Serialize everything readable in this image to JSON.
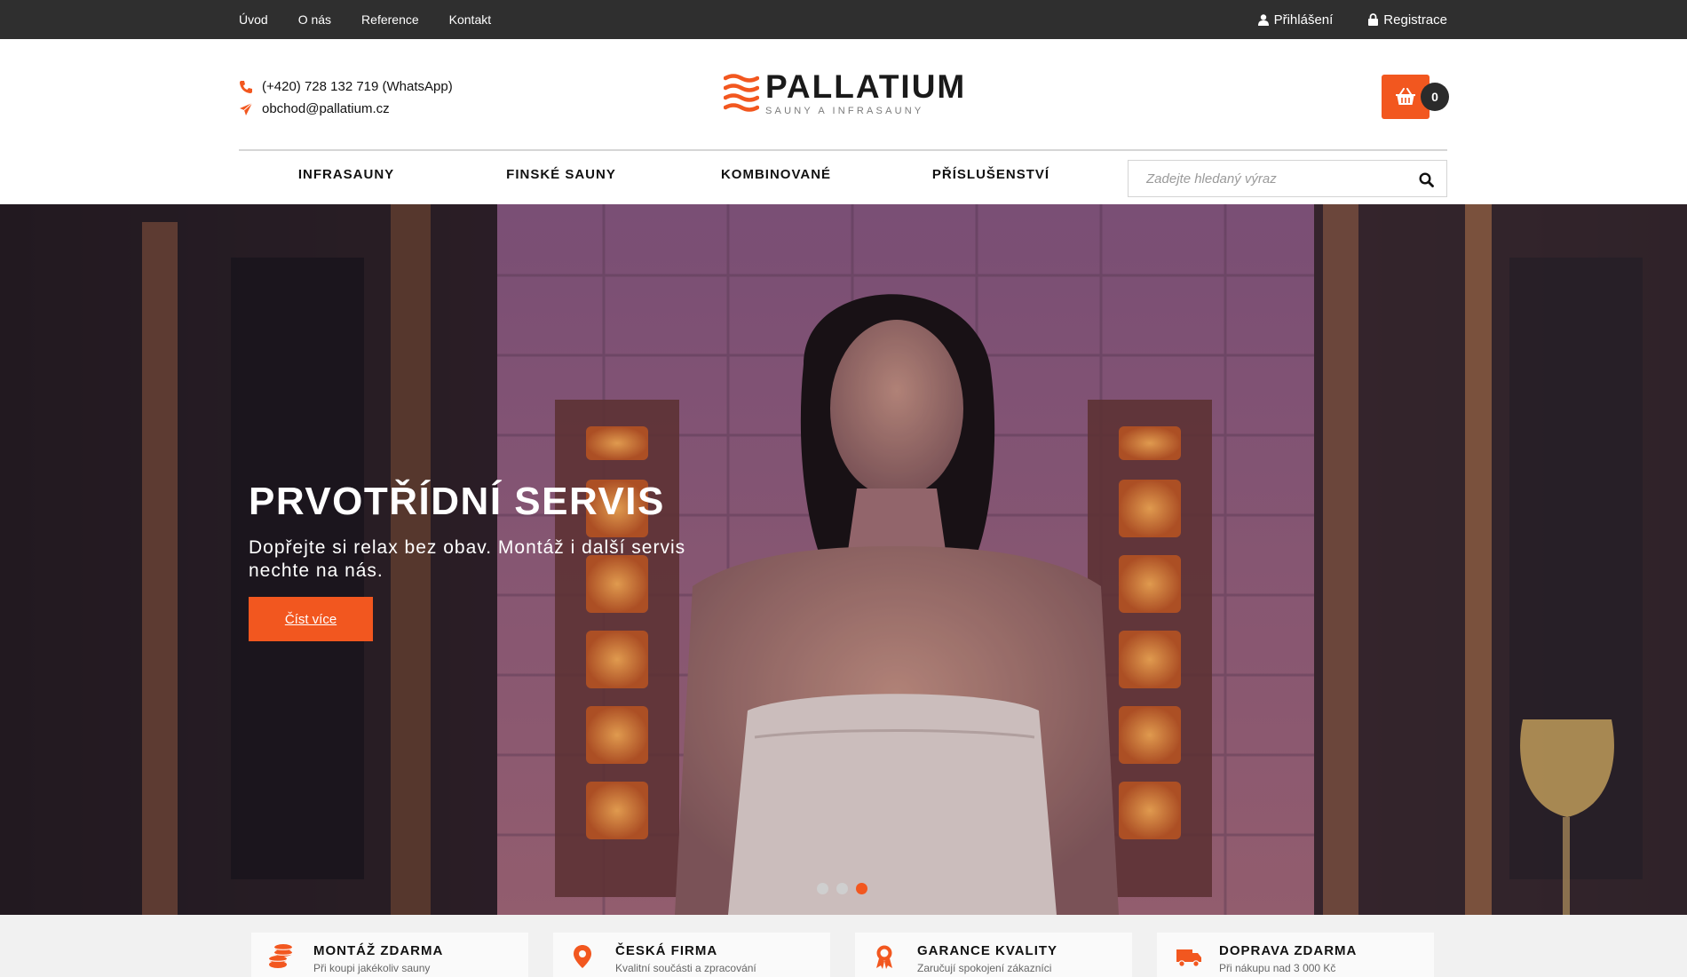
{
  "topbar": {
    "links": [
      "Úvod",
      "O nás",
      "Reference",
      "Kontakt"
    ],
    "login_label": "Přihlášení",
    "register_label": "Registrace"
  },
  "header": {
    "phone": "(+420) 728 132 719 (WhatsApp)",
    "email": "obchod@pallatium.cz",
    "logo_name": "PALLATIUM",
    "logo_tagline": "SAUNY A INFRASAUNY",
    "cart_count": "0"
  },
  "nav": {
    "items": [
      "INFRASAUNY",
      "FINSKÉ SAUNY",
      "KOMBINOVANÉ",
      "PŘÍSLUŠENSTVÍ"
    ]
  },
  "search": {
    "placeholder": "Zadejte hledaný výraz"
  },
  "hero": {
    "title": "PRVOTŘÍDNÍ SERVIS",
    "subtitle": "Dopřejte si relax bez obav. Montáž i další servis nechte na nás.",
    "button_label": "Číst více",
    "slides": 3,
    "active_slide": 3
  },
  "features": [
    {
      "icon": "coins-icon",
      "title": "MONTÁŽ ZDARMA",
      "subtitle": "Při koupi jakékoliv sauny"
    },
    {
      "icon": "map-marker-icon",
      "title": "ČESKÁ FIRMA",
      "subtitle": "Kvalitní součásti a zpracování"
    },
    {
      "icon": "award-icon",
      "title": "GARANCE KVALITY",
      "subtitle": "Zaručují spokojení zákazníci"
    },
    {
      "icon": "truck-icon",
      "title": "DOPRAVA ZDARMA",
      "subtitle": "Při nákupu nad 3 000 Kč"
    }
  ],
  "colors": {
    "accent": "#f2571f",
    "topbar": "#2f2f2f",
    "feature_bg": "#f1f1f1"
  }
}
